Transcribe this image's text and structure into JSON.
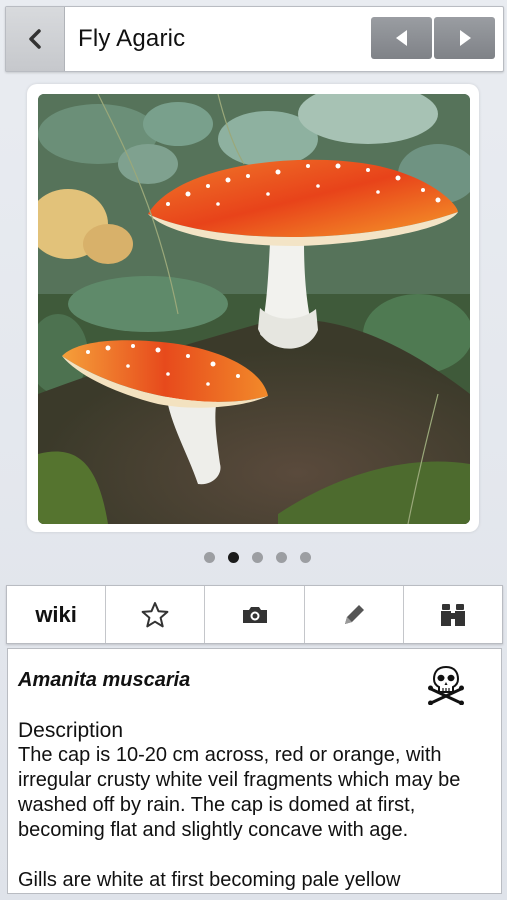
{
  "header": {
    "back_icon": "chevron-left-icon",
    "title": "Fly Agaric",
    "prev_icon": "triangle-left-icon",
    "next_icon": "triangle-right-icon"
  },
  "gallery": {
    "image": "fly-agaric-mushroom-photo",
    "page_count": 5,
    "active_page": 2
  },
  "toolbar": {
    "wiki_label": "wiki",
    "icons": [
      "star-icon",
      "camera-icon",
      "pencil-icon",
      "binoculars-icon"
    ]
  },
  "details": {
    "scientific_name": "Amanita muscaria",
    "toxicity_icon": "skull-crossbones-icon",
    "description_heading": "Description",
    "description_paragraphs": [
      "The cap is 10-20 cm across, red or orange, with irregular crusty white veil fragments which may be washed off by rain. The cap is domed at first, becoming flat and slightly concave with age.",
      "Gills are white at first becoming pale yellow"
    ]
  },
  "colors": {
    "cap_red": "#e8431a",
    "cap_orange": "#f59a2a",
    "toolbar_border": "#b9bcc2"
  }
}
